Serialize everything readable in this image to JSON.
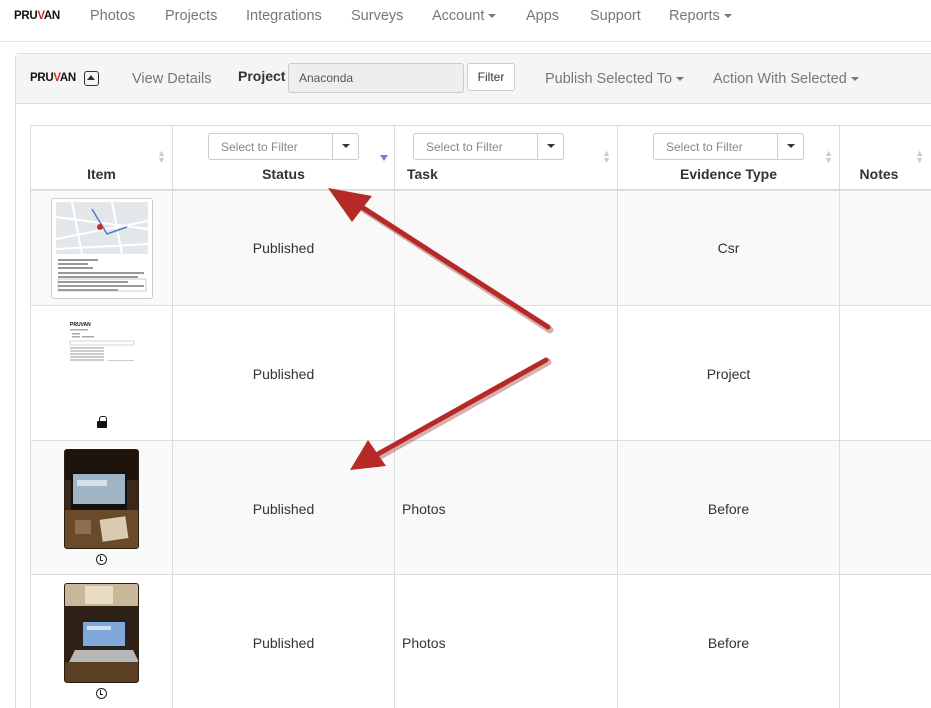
{
  "navbar": {
    "logo": {
      "pre": "PRU",
      "v": "V",
      "post": "AN"
    },
    "items": [
      {
        "label": "Photos",
        "dropdown": false
      },
      {
        "label": "Projects",
        "dropdown": false
      },
      {
        "label": "Integrations",
        "dropdown": false
      },
      {
        "label": "Surveys",
        "dropdown": false
      },
      {
        "label": "Account",
        "dropdown": true
      },
      {
        "label": "Apps",
        "dropdown": false
      },
      {
        "label": "Support",
        "dropdown": false
      },
      {
        "label": "Reports",
        "dropdown": true
      }
    ]
  },
  "panel": {
    "logo": {
      "pre": "PRU",
      "v": "V",
      "post": "AN"
    },
    "view_details": "View Details",
    "project_label": "Project",
    "project_value": "Anaconda",
    "filter_button": "Filter",
    "publish_menu": "Publish Selected To",
    "action_menu": "Action With Selected"
  },
  "table": {
    "columns": [
      {
        "label": "Item",
        "filter": null
      },
      {
        "label": "Status",
        "filter": "Select to Filter"
      },
      {
        "label": "Task",
        "filter": "Select to Filter"
      },
      {
        "label": "Evidence Type",
        "filter": "Select to Filter"
      },
      {
        "label": "Notes",
        "filter": null
      }
    ],
    "rows": [
      {
        "thumbnail": "map-document",
        "status": "Published",
        "task": "",
        "evidence_type": "Csr",
        "notes": "",
        "icon": null
      },
      {
        "thumbnail": "report-document",
        "status": "Published",
        "task": "",
        "evidence_type": "Project",
        "notes": "",
        "icon": "lock-icon"
      },
      {
        "thumbnail": "desk-photo",
        "status": "Published",
        "task": "Photos",
        "evidence_type": "Before",
        "notes": "",
        "icon": "clock-icon"
      },
      {
        "thumbnail": "laptop-photo",
        "status": "Published",
        "task": "Photos",
        "evidence_type": "Before",
        "notes": "",
        "icon": "clock-icon"
      }
    ]
  },
  "colors": {
    "brand_red": "#c9302c",
    "annotation_arrow": "#b52a26",
    "sort_active": "#8877cc",
    "border": "#dddddd"
  }
}
